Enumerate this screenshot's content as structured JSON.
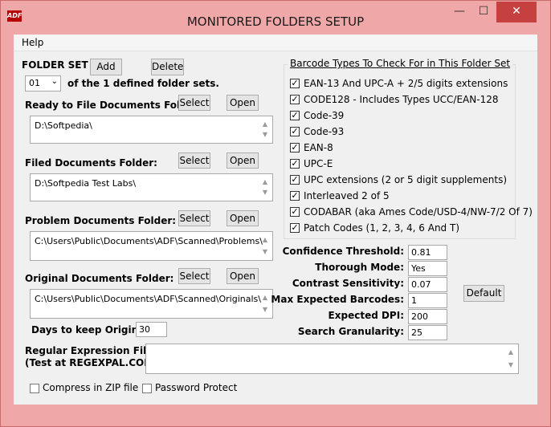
{
  "window": {
    "title": "MONITORED FOLDERS SETUP",
    "icon_text": "ADF",
    "min_glyph": "—",
    "max_glyph": "☐",
    "close_glyph": "✕"
  },
  "menu": {
    "help": "Help"
  },
  "folder_set": {
    "label": "FOLDER SET",
    "add": "Add",
    "delete": "Delete",
    "selected": "01",
    "summary": "of the 1 defined folder sets."
  },
  "folders": {
    "ready": {
      "label": "Ready to File Documents Folder:",
      "value": "D:\\Softpedia\\"
    },
    "filed": {
      "label": "Filed Documents Folder:",
      "value": "D:\\Softpedia Test Labs\\"
    },
    "problem": {
      "label": "Problem Documents Folder:",
      "value": "C:\\Users\\Public\\Documents\\ADF\\Scanned\\Problems\\"
    },
    "original": {
      "label": "Original Documents Folder:",
      "value": "C:\\Users\\Public\\Documents\\ADF\\Scanned\\Originals\\"
    },
    "select": "Select",
    "open": "Open"
  },
  "days": {
    "label": "Days to keep Originals:",
    "value": "30"
  },
  "regex": {
    "label_line1": "Regular Expression Filter:",
    "label_line2": "(Test at REGEXPAL.COM)",
    "value": ""
  },
  "options": {
    "zip": "Compress in ZIP file",
    "password": "Password Protect"
  },
  "barcodes": {
    "title": "Barcode Types To Check For in This Folder Set",
    "items": [
      {
        "label": "EAN-13 And UPC-A + 2/5 digits extensions",
        "checked": true
      },
      {
        "label": "CODE128 - Includes Types UCC/EAN-128",
        "checked": true
      },
      {
        "label": "Code-39",
        "checked": true
      },
      {
        "label": "Code-93",
        "checked": true
      },
      {
        "label": "EAN-8",
        "checked": true
      },
      {
        "label": "UPC-E",
        "checked": true
      },
      {
        "label": "UPC extensions (2 or 5 digit supplements)",
        "checked": true
      },
      {
        "label": "Interleaved 2 of 5",
        "checked": true
      },
      {
        "label": "CODABAR (aka Ames Code/USD-4/NW-7/2 Of 7)",
        "checked": true
      },
      {
        "label": "Patch Codes (1, 2, 3, 4, 6 And T)",
        "checked": true
      }
    ]
  },
  "settings": {
    "confidence": {
      "label": "Confidence Threshold:",
      "value": "0.81"
    },
    "thorough": {
      "label": "Thorough Mode:",
      "value": "Yes"
    },
    "contrast": {
      "label": "Contrast Sensitivity:",
      "value": "0.07"
    },
    "max_barcodes": {
      "label": "Max Expected Barcodes:",
      "value": "1"
    },
    "dpi": {
      "label": "Expected DPI:",
      "value": "200"
    },
    "granularity": {
      "label": "Search Granularity:",
      "value": "25"
    },
    "default": "Default"
  }
}
